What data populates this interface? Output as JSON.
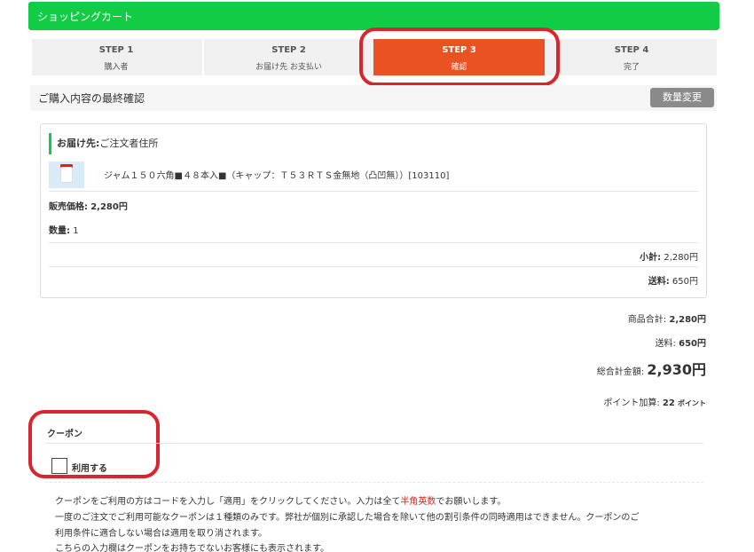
{
  "header": {
    "title": "ショッピングカート"
  },
  "steps": [
    {
      "title": "STEP 1",
      "label": "購入者"
    },
    {
      "title": "STEP 2",
      "label": "お届け先 お支払い"
    },
    {
      "title": "STEP 3",
      "label": "確認"
    },
    {
      "title": "STEP 4",
      "label": "完了"
    }
  ],
  "confirm": {
    "title": "ご購入内容の最終確認",
    "change_qty_label": "数量変更"
  },
  "order": {
    "delivery_label": "お届け先:",
    "delivery_value": "ご注文者住所",
    "product_name": "ジャム１５０六角■４８本入■（キャップ：Ｔ５３ＲＴＳ金無地（凸凹無））[103110]",
    "price_label": "販売価格:",
    "price_value": "2,280円",
    "qty_label": "数量:",
    "qty_value": "1",
    "subtotal_label": "小計:",
    "subtotal_value": "2,280円",
    "shipping_label": "送料:",
    "shipping_value": "650円"
  },
  "totals": {
    "items_label": "商品合計:",
    "items_value": "2,280円",
    "shipping_label": "送料:",
    "shipping_value": "650円",
    "grand_label": "総合計金額:",
    "grand_value": "2,930円",
    "points_label": "ポイント加算:",
    "points_value": "22",
    "points_unit": "ポイント"
  },
  "coupon": {
    "title": "クーポン",
    "use_label": "利用する",
    "note1_a": "クーポンをご利用の方はコードを入力し「適用」をクリックしてください。入力は全て",
    "note1_red": "半角英数",
    "note1_b": "でお願いします。",
    "note2": "一度のご注文でご利用可能なクーポンは１種類のみです。弊社が個別に承認した場合を除いて他の割引条件の同時適用はできません。クーポンのご",
    "note3": "利用条件に適合しない場合は適用を取り消されます。",
    "note4": "こちらの入力欄はクーポンをお持ちでないお客様にも表示されます。"
  },
  "colors": {
    "header_green": "#11cc44",
    "active_step": "#ea5224",
    "highlight_ring": "#d8252e"
  }
}
